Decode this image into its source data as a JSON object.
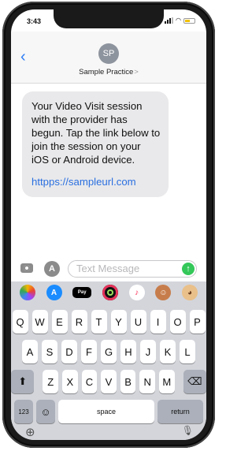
{
  "status_bar": {
    "time": "3:43"
  },
  "header": {
    "avatar_initials": "SP",
    "contact_name": "Sample Practice",
    "chevron": ">",
    "back_glyph": "‹"
  },
  "message": {
    "body": "Your Video Visit session with the provider has begun. Tap the link below to join the session on your iOS or Android device.",
    "link": "httpps://sampleurl.com"
  },
  "composer": {
    "placeholder": "Text Message",
    "apps_glyph": "A",
    "send_glyph": "↑"
  },
  "app_tray": {
    "icons": [
      "photos-icon",
      "app-store-icon",
      "apple-pay-icon",
      "fitness-icon",
      "music-icon",
      "memoji-icon",
      "monkey-icon"
    ],
    "apple_pay_label": "Pay"
  },
  "keyboard": {
    "row1": [
      "Q",
      "W",
      "E",
      "R",
      "T",
      "Y",
      "U",
      "I",
      "O",
      "P"
    ],
    "row2": [
      "A",
      "S",
      "D",
      "F",
      "G",
      "H",
      "J",
      "K",
      "L"
    ],
    "row3": [
      "Z",
      "X",
      "C",
      "V",
      "B",
      "N",
      "M"
    ],
    "numbers_label": "123",
    "space_label": "space",
    "return_label": "return",
    "shift_glyph": "⬆",
    "delete_glyph": "⌫",
    "emoji_glyph": "☺",
    "globe_glyph": "⊕",
    "mic_glyph": "🎙"
  }
}
